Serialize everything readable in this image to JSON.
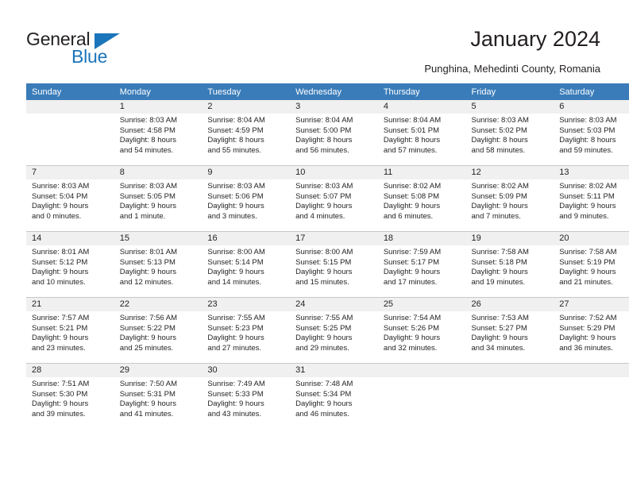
{
  "brand": {
    "name_top": "General",
    "name_bottom": "Blue",
    "triangle_color": "#1b75bb"
  },
  "header": {
    "title": "January 2024",
    "subtitle": "Punghina, Mehedinti County, Romania"
  },
  "theme": {
    "header_blue": "#3a7cb9",
    "daynum_band": "#f0f0f0",
    "text": "#231f20",
    "grid_line": "#c8c8c8"
  },
  "weekdays": [
    "Sunday",
    "Monday",
    "Tuesday",
    "Wednesday",
    "Thursday",
    "Friday",
    "Saturday"
  ],
  "weeks": [
    [
      {
        "day": "",
        "sunrise": "",
        "sunset": "",
        "daylight1": "",
        "daylight2": "",
        "empty": true
      },
      {
        "day": "1",
        "sunrise": "Sunrise: 8:03 AM",
        "sunset": "Sunset: 4:58 PM",
        "daylight1": "Daylight: 8 hours",
        "daylight2": "and 54 minutes."
      },
      {
        "day": "2",
        "sunrise": "Sunrise: 8:04 AM",
        "sunset": "Sunset: 4:59 PM",
        "daylight1": "Daylight: 8 hours",
        "daylight2": "and 55 minutes."
      },
      {
        "day": "3",
        "sunrise": "Sunrise: 8:04 AM",
        "sunset": "Sunset: 5:00 PM",
        "daylight1": "Daylight: 8 hours",
        "daylight2": "and 56 minutes."
      },
      {
        "day": "4",
        "sunrise": "Sunrise: 8:04 AM",
        "sunset": "Sunset: 5:01 PM",
        "daylight1": "Daylight: 8 hours",
        "daylight2": "and 57 minutes."
      },
      {
        "day": "5",
        "sunrise": "Sunrise: 8:03 AM",
        "sunset": "Sunset: 5:02 PM",
        "daylight1": "Daylight: 8 hours",
        "daylight2": "and 58 minutes."
      },
      {
        "day": "6",
        "sunrise": "Sunrise: 8:03 AM",
        "sunset": "Sunset: 5:03 PM",
        "daylight1": "Daylight: 8 hours",
        "daylight2": "and 59 minutes."
      }
    ],
    [
      {
        "day": "7",
        "sunrise": "Sunrise: 8:03 AM",
        "sunset": "Sunset: 5:04 PM",
        "daylight1": "Daylight: 9 hours",
        "daylight2": "and 0 minutes."
      },
      {
        "day": "8",
        "sunrise": "Sunrise: 8:03 AM",
        "sunset": "Sunset: 5:05 PM",
        "daylight1": "Daylight: 9 hours",
        "daylight2": "and 1 minute."
      },
      {
        "day": "9",
        "sunrise": "Sunrise: 8:03 AM",
        "sunset": "Sunset: 5:06 PM",
        "daylight1": "Daylight: 9 hours",
        "daylight2": "and 3 minutes."
      },
      {
        "day": "10",
        "sunrise": "Sunrise: 8:03 AM",
        "sunset": "Sunset: 5:07 PM",
        "daylight1": "Daylight: 9 hours",
        "daylight2": "and 4 minutes."
      },
      {
        "day": "11",
        "sunrise": "Sunrise: 8:02 AM",
        "sunset": "Sunset: 5:08 PM",
        "daylight1": "Daylight: 9 hours",
        "daylight2": "and 6 minutes."
      },
      {
        "day": "12",
        "sunrise": "Sunrise: 8:02 AM",
        "sunset": "Sunset: 5:09 PM",
        "daylight1": "Daylight: 9 hours",
        "daylight2": "and 7 minutes."
      },
      {
        "day": "13",
        "sunrise": "Sunrise: 8:02 AM",
        "sunset": "Sunset: 5:11 PM",
        "daylight1": "Daylight: 9 hours",
        "daylight2": "and 9 minutes."
      }
    ],
    [
      {
        "day": "14",
        "sunrise": "Sunrise: 8:01 AM",
        "sunset": "Sunset: 5:12 PM",
        "daylight1": "Daylight: 9 hours",
        "daylight2": "and 10 minutes."
      },
      {
        "day": "15",
        "sunrise": "Sunrise: 8:01 AM",
        "sunset": "Sunset: 5:13 PM",
        "daylight1": "Daylight: 9 hours",
        "daylight2": "and 12 minutes."
      },
      {
        "day": "16",
        "sunrise": "Sunrise: 8:00 AM",
        "sunset": "Sunset: 5:14 PM",
        "daylight1": "Daylight: 9 hours",
        "daylight2": "and 14 minutes."
      },
      {
        "day": "17",
        "sunrise": "Sunrise: 8:00 AM",
        "sunset": "Sunset: 5:15 PM",
        "daylight1": "Daylight: 9 hours",
        "daylight2": "and 15 minutes."
      },
      {
        "day": "18",
        "sunrise": "Sunrise: 7:59 AM",
        "sunset": "Sunset: 5:17 PM",
        "daylight1": "Daylight: 9 hours",
        "daylight2": "and 17 minutes."
      },
      {
        "day": "19",
        "sunrise": "Sunrise: 7:58 AM",
        "sunset": "Sunset: 5:18 PM",
        "daylight1": "Daylight: 9 hours",
        "daylight2": "and 19 minutes."
      },
      {
        "day": "20",
        "sunrise": "Sunrise: 7:58 AM",
        "sunset": "Sunset: 5:19 PM",
        "daylight1": "Daylight: 9 hours",
        "daylight2": "and 21 minutes."
      }
    ],
    [
      {
        "day": "21",
        "sunrise": "Sunrise: 7:57 AM",
        "sunset": "Sunset: 5:21 PM",
        "daylight1": "Daylight: 9 hours",
        "daylight2": "and 23 minutes."
      },
      {
        "day": "22",
        "sunrise": "Sunrise: 7:56 AM",
        "sunset": "Sunset: 5:22 PM",
        "daylight1": "Daylight: 9 hours",
        "daylight2": "and 25 minutes."
      },
      {
        "day": "23",
        "sunrise": "Sunrise: 7:55 AM",
        "sunset": "Sunset: 5:23 PM",
        "daylight1": "Daylight: 9 hours",
        "daylight2": "and 27 minutes."
      },
      {
        "day": "24",
        "sunrise": "Sunrise: 7:55 AM",
        "sunset": "Sunset: 5:25 PM",
        "daylight1": "Daylight: 9 hours",
        "daylight2": "and 29 minutes."
      },
      {
        "day": "25",
        "sunrise": "Sunrise: 7:54 AM",
        "sunset": "Sunset: 5:26 PM",
        "daylight1": "Daylight: 9 hours",
        "daylight2": "and 32 minutes."
      },
      {
        "day": "26",
        "sunrise": "Sunrise: 7:53 AM",
        "sunset": "Sunset: 5:27 PM",
        "daylight1": "Daylight: 9 hours",
        "daylight2": "and 34 minutes."
      },
      {
        "day": "27",
        "sunrise": "Sunrise: 7:52 AM",
        "sunset": "Sunset: 5:29 PM",
        "daylight1": "Daylight: 9 hours",
        "daylight2": "and 36 minutes."
      }
    ],
    [
      {
        "day": "28",
        "sunrise": "Sunrise: 7:51 AM",
        "sunset": "Sunset: 5:30 PM",
        "daylight1": "Daylight: 9 hours",
        "daylight2": "and 39 minutes."
      },
      {
        "day": "29",
        "sunrise": "Sunrise: 7:50 AM",
        "sunset": "Sunset: 5:31 PM",
        "daylight1": "Daylight: 9 hours",
        "daylight2": "and 41 minutes."
      },
      {
        "day": "30",
        "sunrise": "Sunrise: 7:49 AM",
        "sunset": "Sunset: 5:33 PM",
        "daylight1": "Daylight: 9 hours",
        "daylight2": "and 43 minutes."
      },
      {
        "day": "31",
        "sunrise": "Sunrise: 7:48 AM",
        "sunset": "Sunset: 5:34 PM",
        "daylight1": "Daylight: 9 hours",
        "daylight2": "and 46 minutes."
      },
      {
        "day": "",
        "sunrise": "",
        "sunset": "",
        "daylight1": "",
        "daylight2": "",
        "empty": true
      },
      {
        "day": "",
        "sunrise": "",
        "sunset": "",
        "daylight1": "",
        "daylight2": "",
        "empty": true
      },
      {
        "day": "",
        "sunrise": "",
        "sunset": "",
        "daylight1": "",
        "daylight2": "",
        "empty": true
      }
    ]
  ]
}
